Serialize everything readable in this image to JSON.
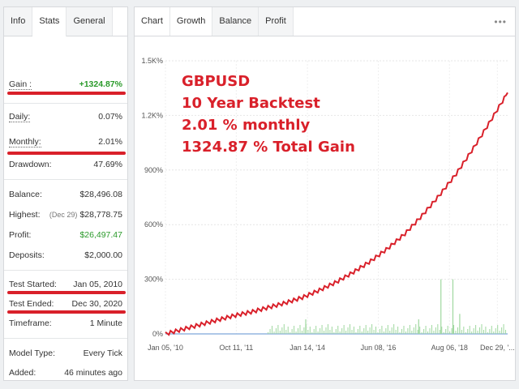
{
  "left": {
    "tabs": [
      "Info",
      "Stats",
      "General"
    ],
    "rows": {
      "gain": {
        "label": "Gain :",
        "value": "+1324.87%"
      },
      "daily": {
        "label": "Daily:",
        "value": "0.07%"
      },
      "monthly": {
        "label": "Monthly:",
        "value": "2.01%"
      },
      "drawdown": {
        "label": "Drawdown:",
        "value": "47.69%"
      },
      "balance": {
        "label": "Balance:",
        "value": "$28,496.08"
      },
      "highest": {
        "label": "Highest:",
        "date": "(Dec 29)",
        "value": "$28,778.75"
      },
      "profit": {
        "label": "Profit:",
        "value": "$26,497.47"
      },
      "deposits": {
        "label": "Deposits:",
        "value": "$2,000.00"
      },
      "test_started": {
        "label": "Test Started:",
        "value": "Jan 05, 2010"
      },
      "test_ended": {
        "label": "Test Ended:",
        "value": "Dec 30, 2020"
      },
      "timeframe": {
        "label": "Timeframe:",
        "value": "1 Minute"
      },
      "model_type": {
        "label": "Model Type:",
        "value": "Every Tick"
      },
      "added": {
        "label": "Added:",
        "value": "46 minutes ago"
      }
    }
  },
  "right": {
    "tabs": [
      "Chart",
      "Growth",
      "Balance",
      "Profit"
    ],
    "menu_icon": "ellipsis-icon",
    "overlay": {
      "line1": "GBPUSD",
      "line2": "10 Year Backtest",
      "line3": "2.01 % monthly",
      "line4": "1324.87 % Total Gain"
    }
  },
  "colors": {
    "growth_line": "#d9202a",
    "volume_bars": "#9fd89f",
    "baseline": "#7fa7d9",
    "highlight": "#d9202a"
  },
  "chart_data": {
    "type": "line",
    "y_ticks": [
      "0%",
      "300%",
      "600%",
      "900%",
      "1.2K%",
      "1.5K%"
    ],
    "y_tick_values": [
      0,
      300,
      600,
      900,
      1200,
      1500
    ],
    "ylim": [
      0,
      1500
    ],
    "x_ticks": [
      "Jan 05, '10",
      "Oct 11, '11",
      "Jan 14, '14",
      "Jun 08, '16",
      "Aug 06, '18",
      "Dec 29, '..."
    ],
    "x_tick_positions": [
      0,
      0.207,
      0.415,
      0.622,
      0.83,
      0.97
    ],
    "grid": true,
    "series": [
      {
        "x": [
          0,
          0.05,
          0.1,
          0.15,
          0.2,
          0.25,
          0.3,
          0.35,
          0.4,
          0.45,
          0.5,
          0.55,
          0.6,
          0.65,
          0.7,
          0.75,
          0.8,
          0.85,
          0.9,
          0.95,
          1.0
        ],
        "values": [
          0,
          25,
          50,
          75,
          100,
          120,
          145,
          170,
          200,
          240,
          285,
          340,
          400,
          470,
          550,
          650,
          760,
          880,
          1020,
          1170,
          1325
        ]
      }
    ],
    "volume_spikes": [
      {
        "x": 0.805,
        "value": 300
      },
      {
        "x": 0.84,
        "value": 300
      },
      {
        "x": 0.86,
        "value": 110
      },
      {
        "x": 0.74,
        "value": 80
      },
      {
        "x": 0.41,
        "value": 80
      }
    ]
  }
}
